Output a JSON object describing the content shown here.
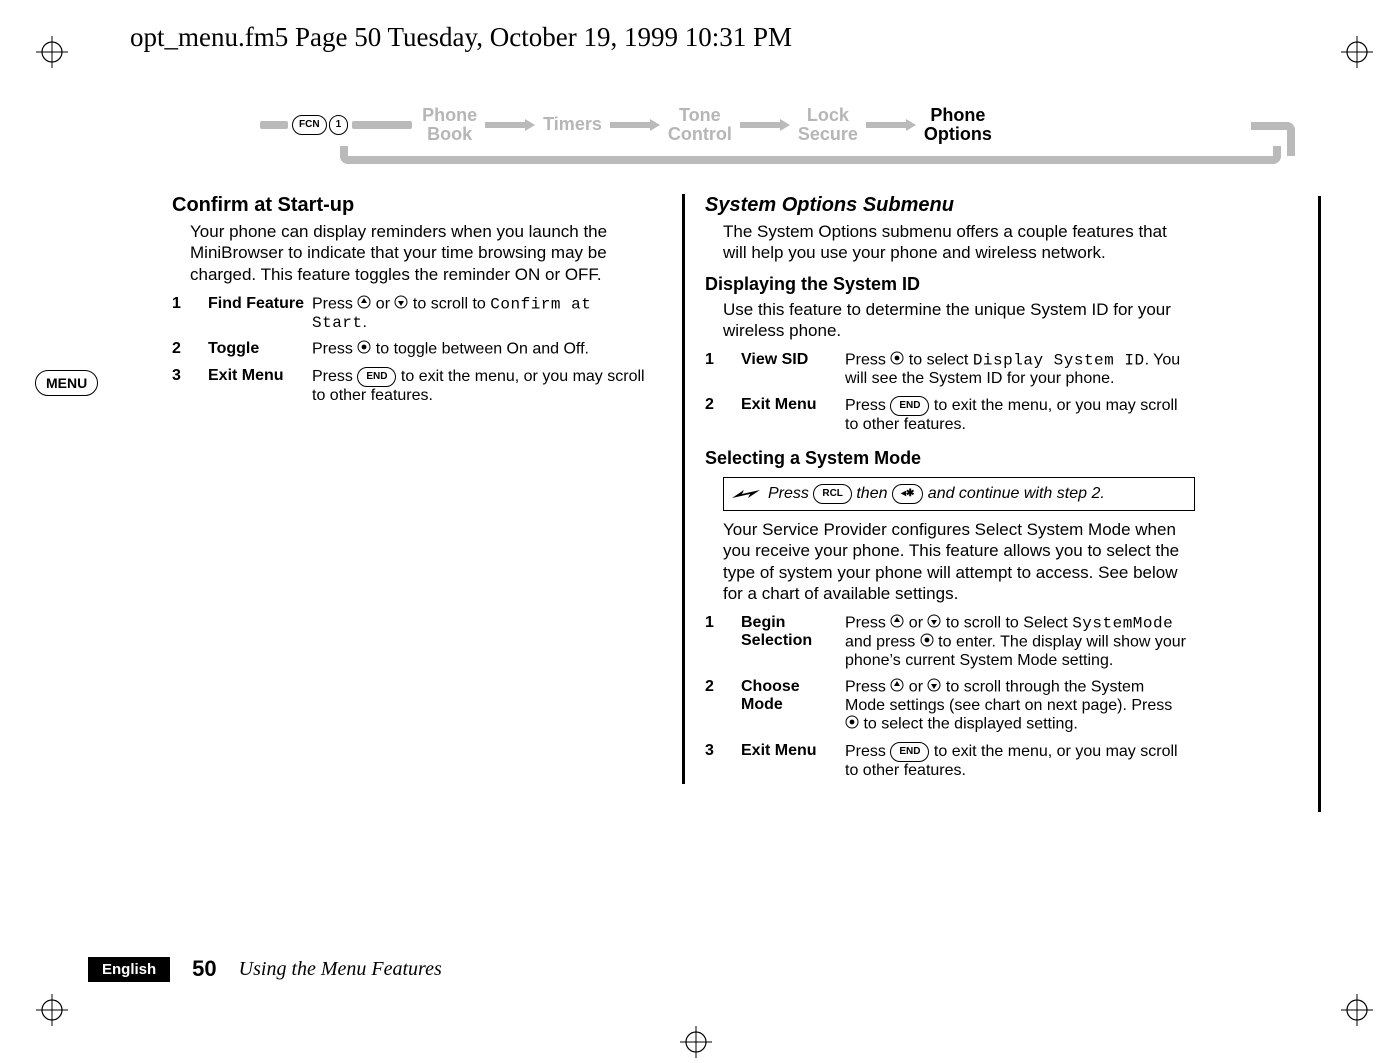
{
  "running_header": "opt_menu.fm5  Page 50  Tuesday, October 19, 1999  10:31 PM",
  "side_tab": "MENU",
  "breadcrumb": {
    "keys": [
      "FCN",
      "1"
    ],
    "items": [
      {
        "line1": "Phone",
        "line2": "Book",
        "active": false
      },
      {
        "line1": "Timers",
        "line2": "",
        "active": false
      },
      {
        "line1": "Tone",
        "line2": "Control",
        "active": false
      },
      {
        "line1": "Lock",
        "line2": "Secure",
        "active": false
      },
      {
        "line1": "Phone",
        "line2": "Options",
        "active": true
      }
    ]
  },
  "left": {
    "heading": "Confirm at Start-up",
    "intro": "Your phone can display reminders when you launch the MiniBrowser to indicate that your time browsing may be charged. This feature toggles the reminder ON or OFF.",
    "steps": [
      {
        "num": "1",
        "label": "Find Feature",
        "text_a": "Press ",
        "text_b": " or ",
        "text_c": " to scroll to ",
        "lcd": "Confirm at Start",
        "text_d": "."
      },
      {
        "num": "2",
        "label": "Toggle",
        "text_a": "Press ",
        "text_b": " to toggle between On and Off."
      },
      {
        "num": "3",
        "label": "Exit Menu",
        "text_a": "Press ",
        "key": "END",
        "text_b": " to exit the menu, or you may scroll to other features."
      }
    ]
  },
  "right": {
    "heading": "System Options Submenu",
    "intro": "The System Options submenu offers a couple features that will help you use your phone and wireless network.",
    "sid_heading": "Displaying the System ID",
    "sid_intro": "Use this feature to determine the unique System ID for your wireless phone.",
    "sid_steps": [
      {
        "num": "1",
        "label": "View SID",
        "text_a": "Press ",
        "text_b": " to select ",
        "lcd": "Display System ID",
        "text_c": ". You will see the System ID for your phone."
      },
      {
        "num": "2",
        "label": "Exit Menu",
        "text_a": "Press ",
        "key": "END",
        "text_b": " to exit the menu, or you may scroll to other features."
      }
    ],
    "mode_heading": "Selecting a System Mode",
    "shortcut": {
      "pre": "Press ",
      "key1": "RCL",
      "mid": " then ",
      "key2": "◂✱",
      "post": " and continue with step 2."
    },
    "mode_intro": "Your Service Provider configures Select System Mode when you receive your phone. This feature allows you to select the type of system your phone will attempt to access. See below for a chart of available settings.",
    "mode_steps": [
      {
        "num": "1",
        "label": "Begin Selection",
        "text_a": "Press ",
        "text_b": " or ",
        "text_c": " to scroll to Select ",
        "lcd": "SystemMode",
        "text_d": " and press ",
        "text_e": " to enter. The display will show your phone’s current System Mode setting."
      },
      {
        "num": "2",
        "label": "Choose Mode",
        "text_a": "Press ",
        "text_b": " or ",
        "text_c": " to scroll through the System Mode settings (see chart on next page). Press ",
        "text_d": " to select the displayed setting."
      },
      {
        "num": "3",
        "label": "Exit Menu",
        "text_a": "Press ",
        "key": "END",
        "text_b": " to exit the menu, or you may scroll to other features."
      }
    ]
  },
  "footer": {
    "lang": "English",
    "page": "50",
    "chapter": "Using the Menu Features"
  }
}
